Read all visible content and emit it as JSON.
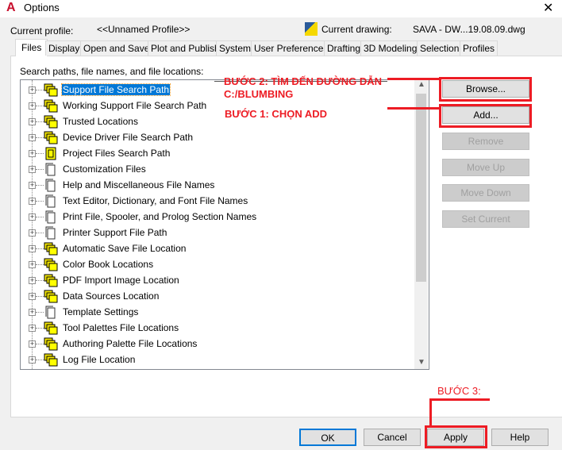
{
  "window": {
    "title": "Options",
    "close": "✕"
  },
  "header": {
    "profile_label": "Current profile:",
    "profile_value": "<<Unnamed Profile>>",
    "drawing_label": "Current drawing:",
    "drawing_value": "SAVA - DW...19.08.09.dwg"
  },
  "tabs": [
    "Files",
    "Display",
    "Open and Save",
    "Plot and Publish",
    "System",
    "User Preferences",
    "Drafting",
    "3D Modeling",
    "Selection",
    "Profiles"
  ],
  "active_tab": "Files",
  "list_label": "Search paths, file names, and file locations:",
  "tree": [
    {
      "label": "Support File Search Path",
      "icon": "folders-icon",
      "selected": true
    },
    {
      "label": "Working Support File Search Path",
      "icon": "folders-icon"
    },
    {
      "label": "Trusted Locations",
      "icon": "folders-icon"
    },
    {
      "label": "Device Driver File Search Path",
      "icon": "folders-icon"
    },
    {
      "label": "Project Files Search Path",
      "icon": "project-icon"
    },
    {
      "label": "Customization Files",
      "icon": "file-icon"
    },
    {
      "label": "Help and Miscellaneous File Names",
      "icon": "file-icon"
    },
    {
      "label": "Text Editor, Dictionary, and Font File Names",
      "icon": "file-icon"
    },
    {
      "label": "Print File, Spooler, and Prolog Section Names",
      "icon": "file-icon"
    },
    {
      "label": "Printer Support File Path",
      "icon": "file-icon"
    },
    {
      "label": "Automatic Save File Location",
      "icon": "folders-icon"
    },
    {
      "label": "Color Book Locations",
      "icon": "folders-icon"
    },
    {
      "label": "PDF Import Image Location",
      "icon": "folders-icon"
    },
    {
      "label": "Data Sources Location",
      "icon": "folders-icon"
    },
    {
      "label": "Template Settings",
      "icon": "file-icon"
    },
    {
      "label": "Tool Palettes File Locations",
      "icon": "folders-icon"
    },
    {
      "label": "Authoring Palette File Locations",
      "icon": "folders-icon"
    },
    {
      "label": "Log File Location",
      "icon": "folders-icon"
    }
  ],
  "side_buttons": {
    "browse": "Browse...",
    "add": "Add...",
    "remove": "Remove",
    "move_up": "Move Up",
    "move_down": "Move Down",
    "set_current": "Set Current"
  },
  "footer": {
    "ok": "OK",
    "cancel": "Cancel",
    "apply": "Apply",
    "help": "Help"
  },
  "annotations": {
    "step2_line1": "BƯỚC 2: TÌM ĐẾN ĐƯỜNG DẪN",
    "step2_line2": "C:/BLUMBING",
    "step1": "BƯỚC 1: CHỌN ADD",
    "step3": "BƯỚC 3:",
    "color": "#ed1c24"
  }
}
